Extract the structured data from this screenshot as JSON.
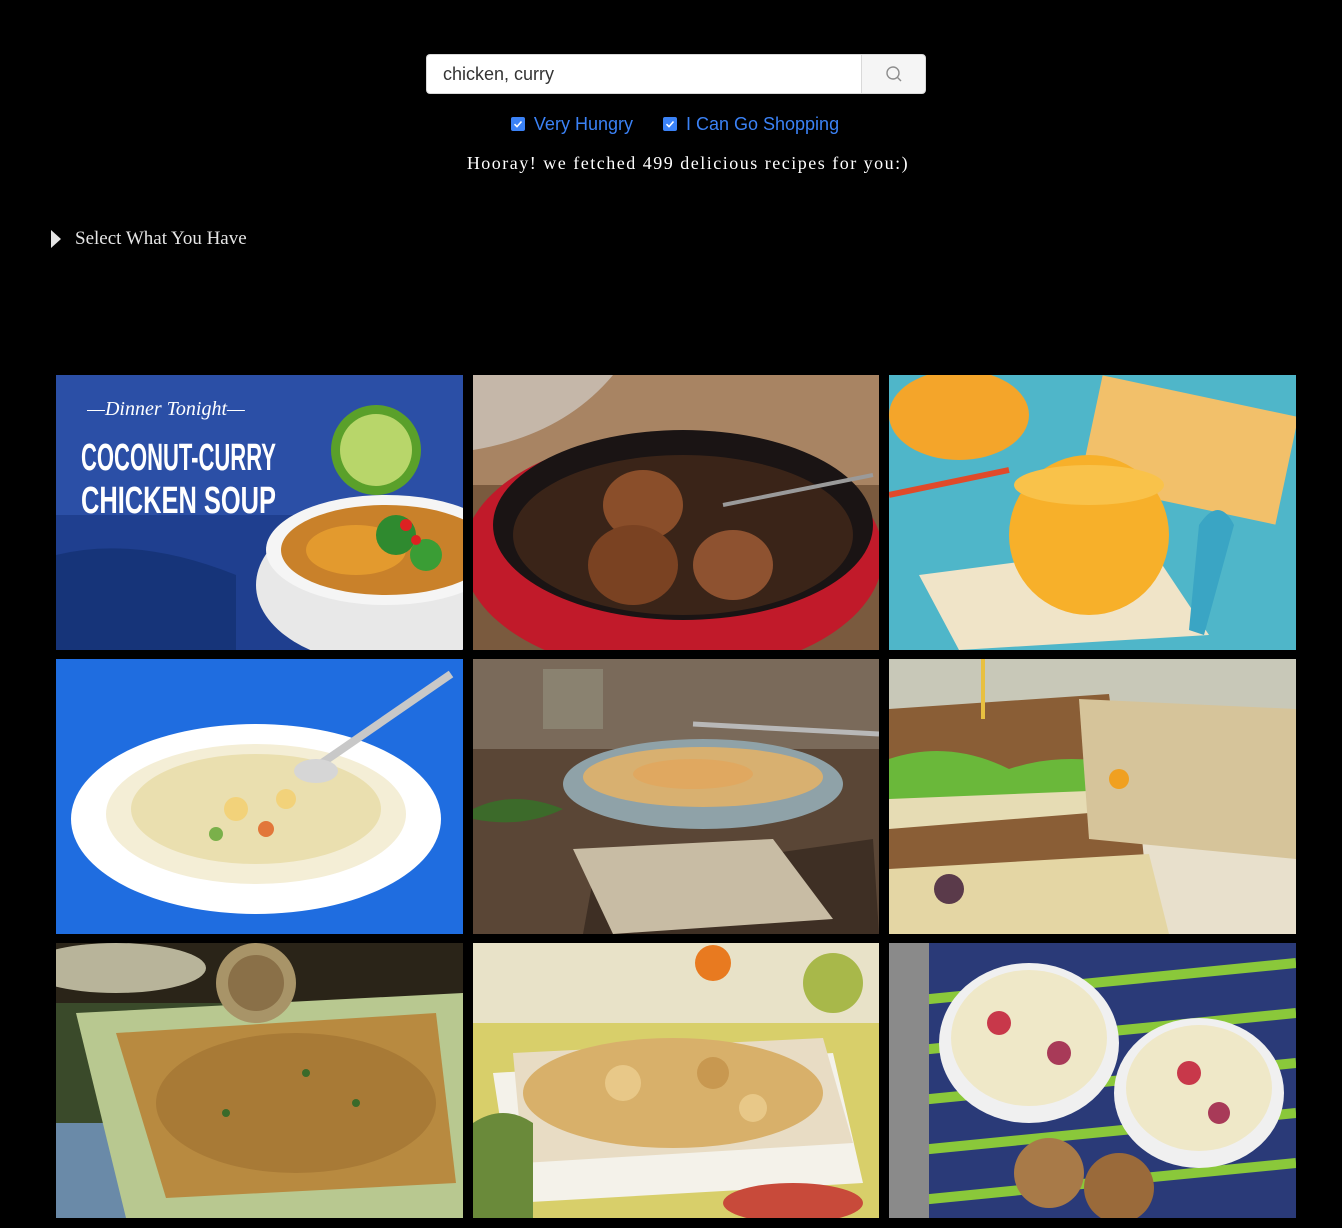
{
  "search": {
    "value": "chicken, curry",
    "placeholder": "",
    "button_icon": "search-icon"
  },
  "filters": [
    {
      "label": "Very Hungry",
      "checked": true
    },
    {
      "label": "I Can Go Shopping",
      "checked": true
    }
  ],
  "status": "Hooray! we fetched 499 delicious recipes for you:)",
  "select_section": {
    "label": "Select What You Have",
    "icon": "caret-right-icon",
    "expanded": false
  },
  "recipes": [
    {
      "overlay_title": "—Dinner Tonight—",
      "overlay_lines": [
        "COCONUT-CURRY",
        "CHICKEN SOUP"
      ]
    },
    {},
    {},
    {},
    {},
    {},
    {},
    {},
    {}
  ],
  "colors": {
    "background": "#000000",
    "accent": "#3b82f6",
    "text": "#ffffff"
  }
}
